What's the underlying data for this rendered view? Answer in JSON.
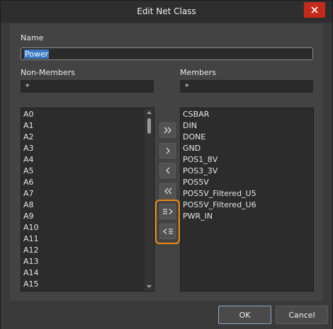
{
  "window": {
    "title": "Edit Net Class"
  },
  "name_section": {
    "label": "Name",
    "value": "Power"
  },
  "non_members": {
    "label": "Non-Members",
    "filter": "*",
    "items": [
      "A0",
      "A1",
      "A2",
      "A3",
      "A4",
      "A5",
      "A6",
      "A7",
      "A8",
      "A9",
      "A10",
      "A11",
      "A12",
      "A13",
      "A14",
      "A15"
    ]
  },
  "members": {
    "label": "Members",
    "filter": "*",
    "items": [
      "CSBAR",
      "DIN",
      "DONE",
      "GND",
      "POS1_8V",
      "POS3_3V",
      "POS5V",
      "POS5V_Filtered_U5",
      "POS5V_Filtered_U6",
      "PWR_IN"
    ]
  },
  "move_buttons": [
    "move-all-right",
    "move-right",
    "move-left",
    "move-all-left",
    "move-selected-to-members",
    "move-selected-to-non-members"
  ],
  "footer": {
    "ok_label": "OK",
    "cancel_label": "Cancel"
  },
  "colors": {
    "accent_highlight": "#f08c10",
    "close": "#c42b1c",
    "selection": "#3a78c4"
  }
}
